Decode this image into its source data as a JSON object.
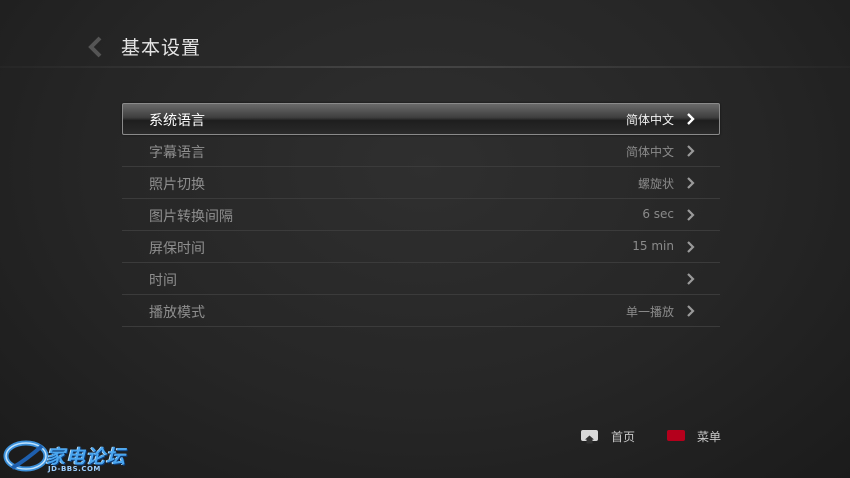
{
  "header": {
    "title": "基本设置"
  },
  "settings": {
    "items": [
      {
        "label": "系统语言",
        "value": "简体中文"
      },
      {
        "label": "字幕语言",
        "value": "简体中文"
      },
      {
        "label": "照片切换",
        "value": "螺旋状"
      },
      {
        "label": "图片转换间隔",
        "value": "6 sec"
      },
      {
        "label": "屏保时间",
        "value": "15 min"
      },
      {
        "label": "时间",
        "value": ""
      },
      {
        "label": "播放模式",
        "value": "单一播放"
      }
    ],
    "selected_index": 0
  },
  "footer": {
    "home_label": "首页",
    "menu_label": "菜单"
  },
  "watermark": {
    "text": "家电论坛",
    "sub": "JD-BBS.COM"
  },
  "colors": {
    "accent_red": "#b4001c",
    "home_key": "#d9d9d9"
  }
}
